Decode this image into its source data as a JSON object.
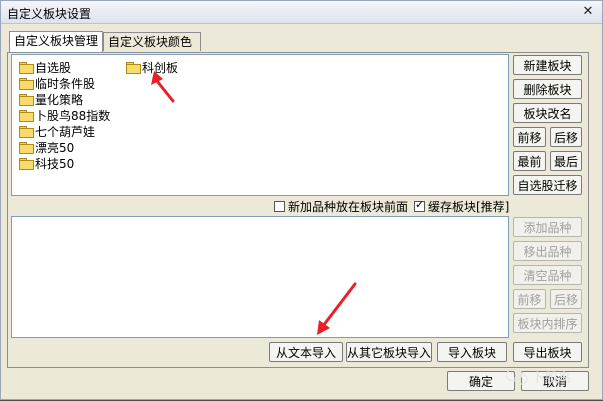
{
  "window": {
    "title": "自定义板块设置",
    "close_symbol": "✕"
  },
  "tabs": [
    {
      "label": "自定义板块管理",
      "active": true
    },
    {
      "label": "自定义板块颜色",
      "active": false
    }
  ],
  "blocks": [
    "自选股",
    "临时条件股",
    "量化策略",
    "卜股鸟88指数",
    "七个葫芦娃",
    "漂亮50",
    "科技50",
    "科创板"
  ],
  "right_buttons": {
    "new_block": "新建板块",
    "delete_block": "删除板块",
    "rename_block": "板块改名",
    "move_up": "前移",
    "move_down": "后移",
    "move_first": "最前",
    "move_last": "最后",
    "migrate_watchlist": "自选股迁移"
  },
  "options": {
    "new_items_front": {
      "label": "新加品种放在板块前面",
      "checked": false
    },
    "cache_blocks": {
      "label": "缓存板块[推荐]",
      "checked": true
    }
  },
  "stock_buttons": {
    "add_item": "添加品种",
    "remove_item": "移出品种",
    "clear_items": "清空品种",
    "move_up": "前移",
    "move_down": "后移",
    "sort_in_block": "板块内排序"
  },
  "bottom_buttons": {
    "import_text": "从文本导入",
    "import_other": "从其它板块导入",
    "import_block": "导入板块",
    "export_block": "导出板块"
  },
  "dialog_buttons": {
    "ok": "确定",
    "cancel": "取消"
  },
  "watermark": {
    "text": "卜股鸟"
  },
  "colors": {
    "arrow": "#e8202a",
    "accent": "#7f9db9"
  }
}
